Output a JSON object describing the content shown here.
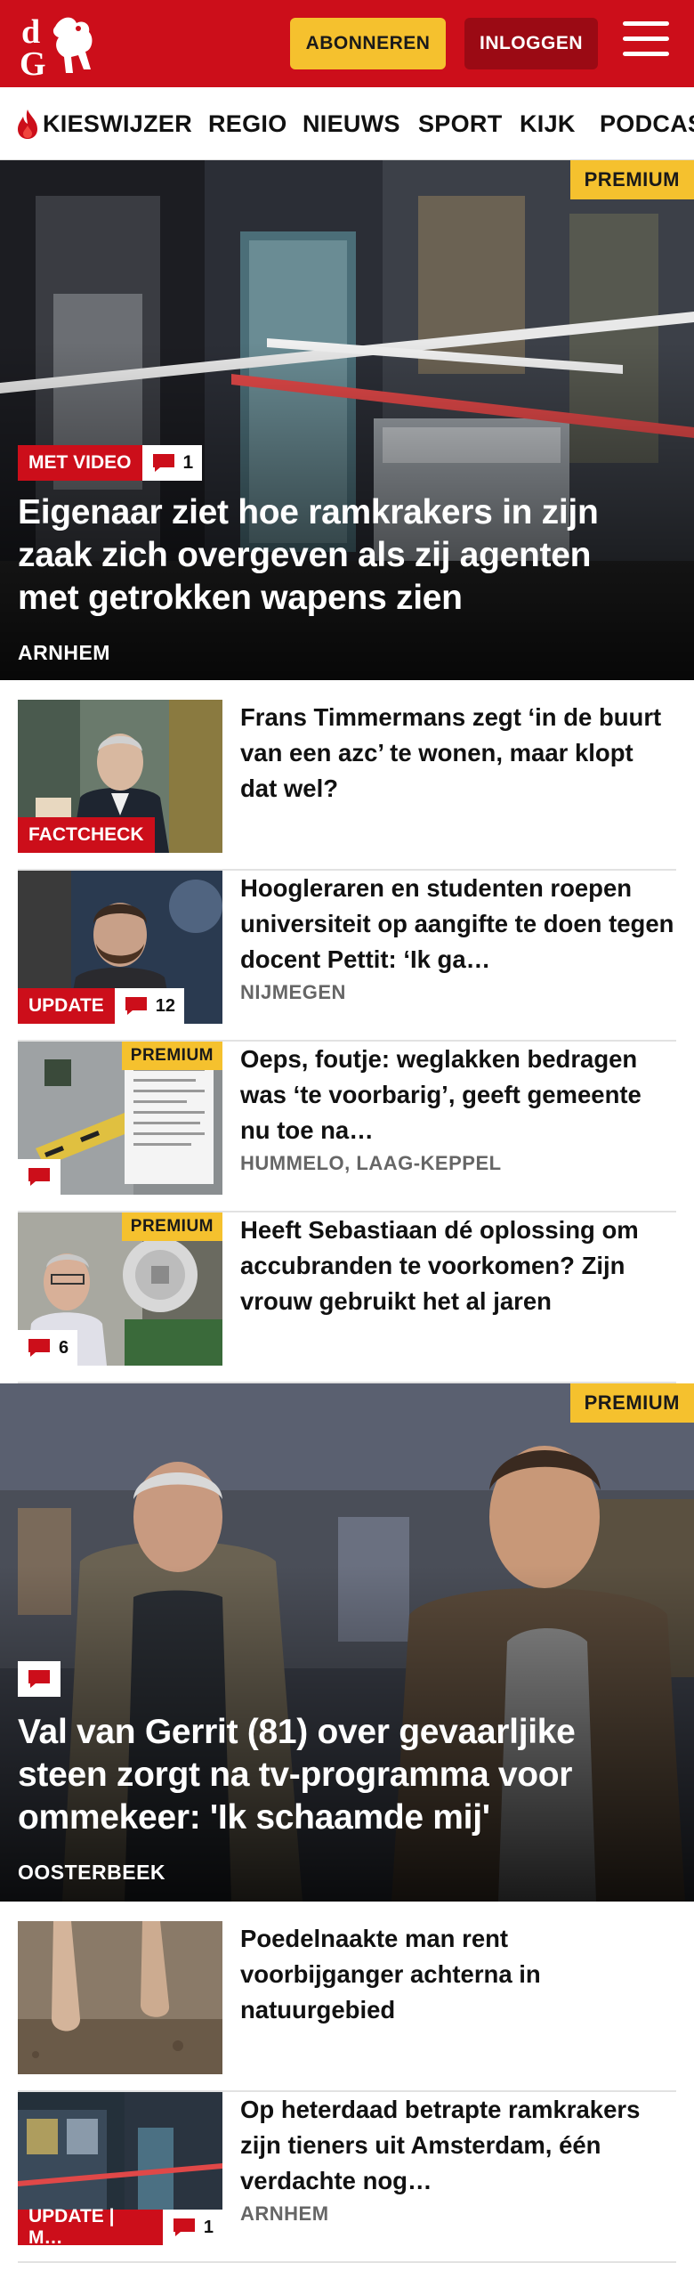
{
  "header": {
    "logo_text": "dG",
    "subscribe_label": "ABONNEREN",
    "login_label": "INLOGGEN",
    "brand_color": "#cc0e1a"
  },
  "nav": {
    "items": [
      {
        "label": "KIESWIJZER",
        "icon": "flame-icon"
      },
      {
        "label": "REGIO"
      },
      {
        "label": "NIEUWS"
      },
      {
        "label": "SPORT"
      },
      {
        "label": "KIJK"
      },
      {
        "label": "PODCAS"
      }
    ]
  },
  "articles": [
    {
      "kind": "hero",
      "premium": "PREMIUM",
      "label": "MET VIDEO",
      "comments": "1",
      "title": "Eigenaar ziet hoe ramkrakers in zijn zaak zich overgeven als zij agenten met getrokken wapens zien",
      "location": "ARNHEM"
    },
    {
      "kind": "row",
      "label": "FACTCHECK",
      "title": "Frans Timmermans zegt ‘in de buurt van een azc’ te wonen, maar klopt dat wel?",
      "location": ""
    },
    {
      "kind": "row",
      "label": "UPDATE",
      "comments": "12",
      "title": "Hoogleraren en studenten roepen universiteit op aangifte te doen tegen docent Pettit: ‘Ik ga…",
      "location": "NIJMEGEN"
    },
    {
      "kind": "row",
      "premium": "PREMIUM",
      "comments": "",
      "title": "Oeps, foutje: weglakken bedragen was ‘te voorbarig’, geeft gemeente nu toe na…",
      "location": "HUMMELO, LAAG-KEPPEL"
    },
    {
      "kind": "row",
      "premium": "PREMIUM",
      "comments": "6",
      "title": "Heeft Sebastiaan dé oplossing om accubranden te voorkomen? Zijn vrouw gebruikt het al jaren",
      "location": ""
    },
    {
      "kind": "hero",
      "premium": "PREMIUM",
      "comments": "",
      "title": "Val van Gerrit (81) over gevaarljike steen zorgt na tv-programma voor ommekeer: 'Ik schaamde mij'",
      "location": "OOSTERBEEK"
    },
    {
      "kind": "row",
      "title": "Poedelnaakte man rent voorbijganger achterna in natuurgebied",
      "location": ""
    },
    {
      "kind": "row",
      "label": "UPDATE | M…",
      "comments": "1",
      "title": "Op heterdaad betrapte ramkrakers zijn tieners uit Amsterdam, één verdachte nog…",
      "location": "ARNHEM"
    }
  ]
}
